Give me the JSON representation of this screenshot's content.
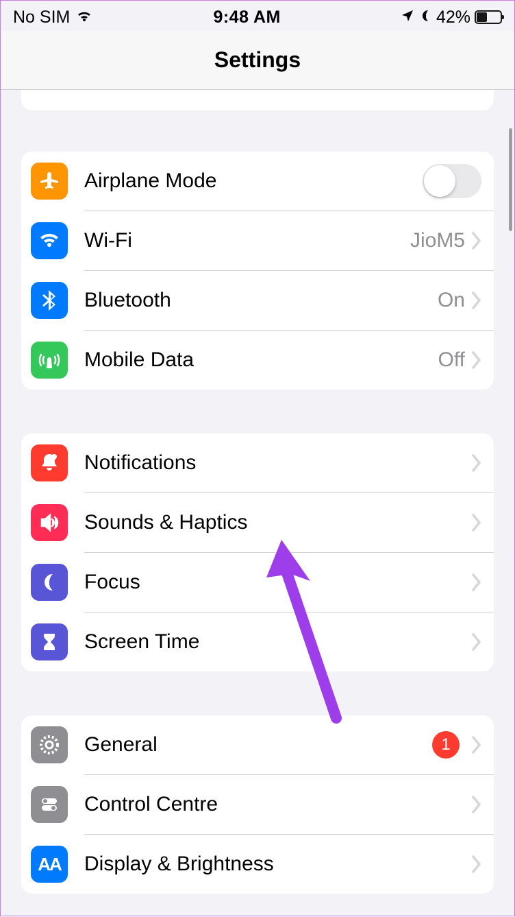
{
  "status": {
    "carrier": "No SIM",
    "time": "9:48 AM",
    "battery_pct": "42%"
  },
  "header": {
    "title": "Settings"
  },
  "groups": {
    "network": {
      "airplane": "Airplane Mode",
      "wifi": "Wi-Fi",
      "wifi_detail": "JioM5",
      "bluetooth": "Bluetooth",
      "bluetooth_detail": "On",
      "mobile_data": "Mobile Data",
      "mobile_data_detail": "Off"
    },
    "alerts": {
      "notifications": "Notifications",
      "sounds": "Sounds & Haptics",
      "focus": "Focus",
      "screen_time": "Screen Time"
    },
    "system": {
      "general": "General",
      "general_badge": "1",
      "control_centre": "Control Centre",
      "display": "Display & Brightness"
    }
  }
}
